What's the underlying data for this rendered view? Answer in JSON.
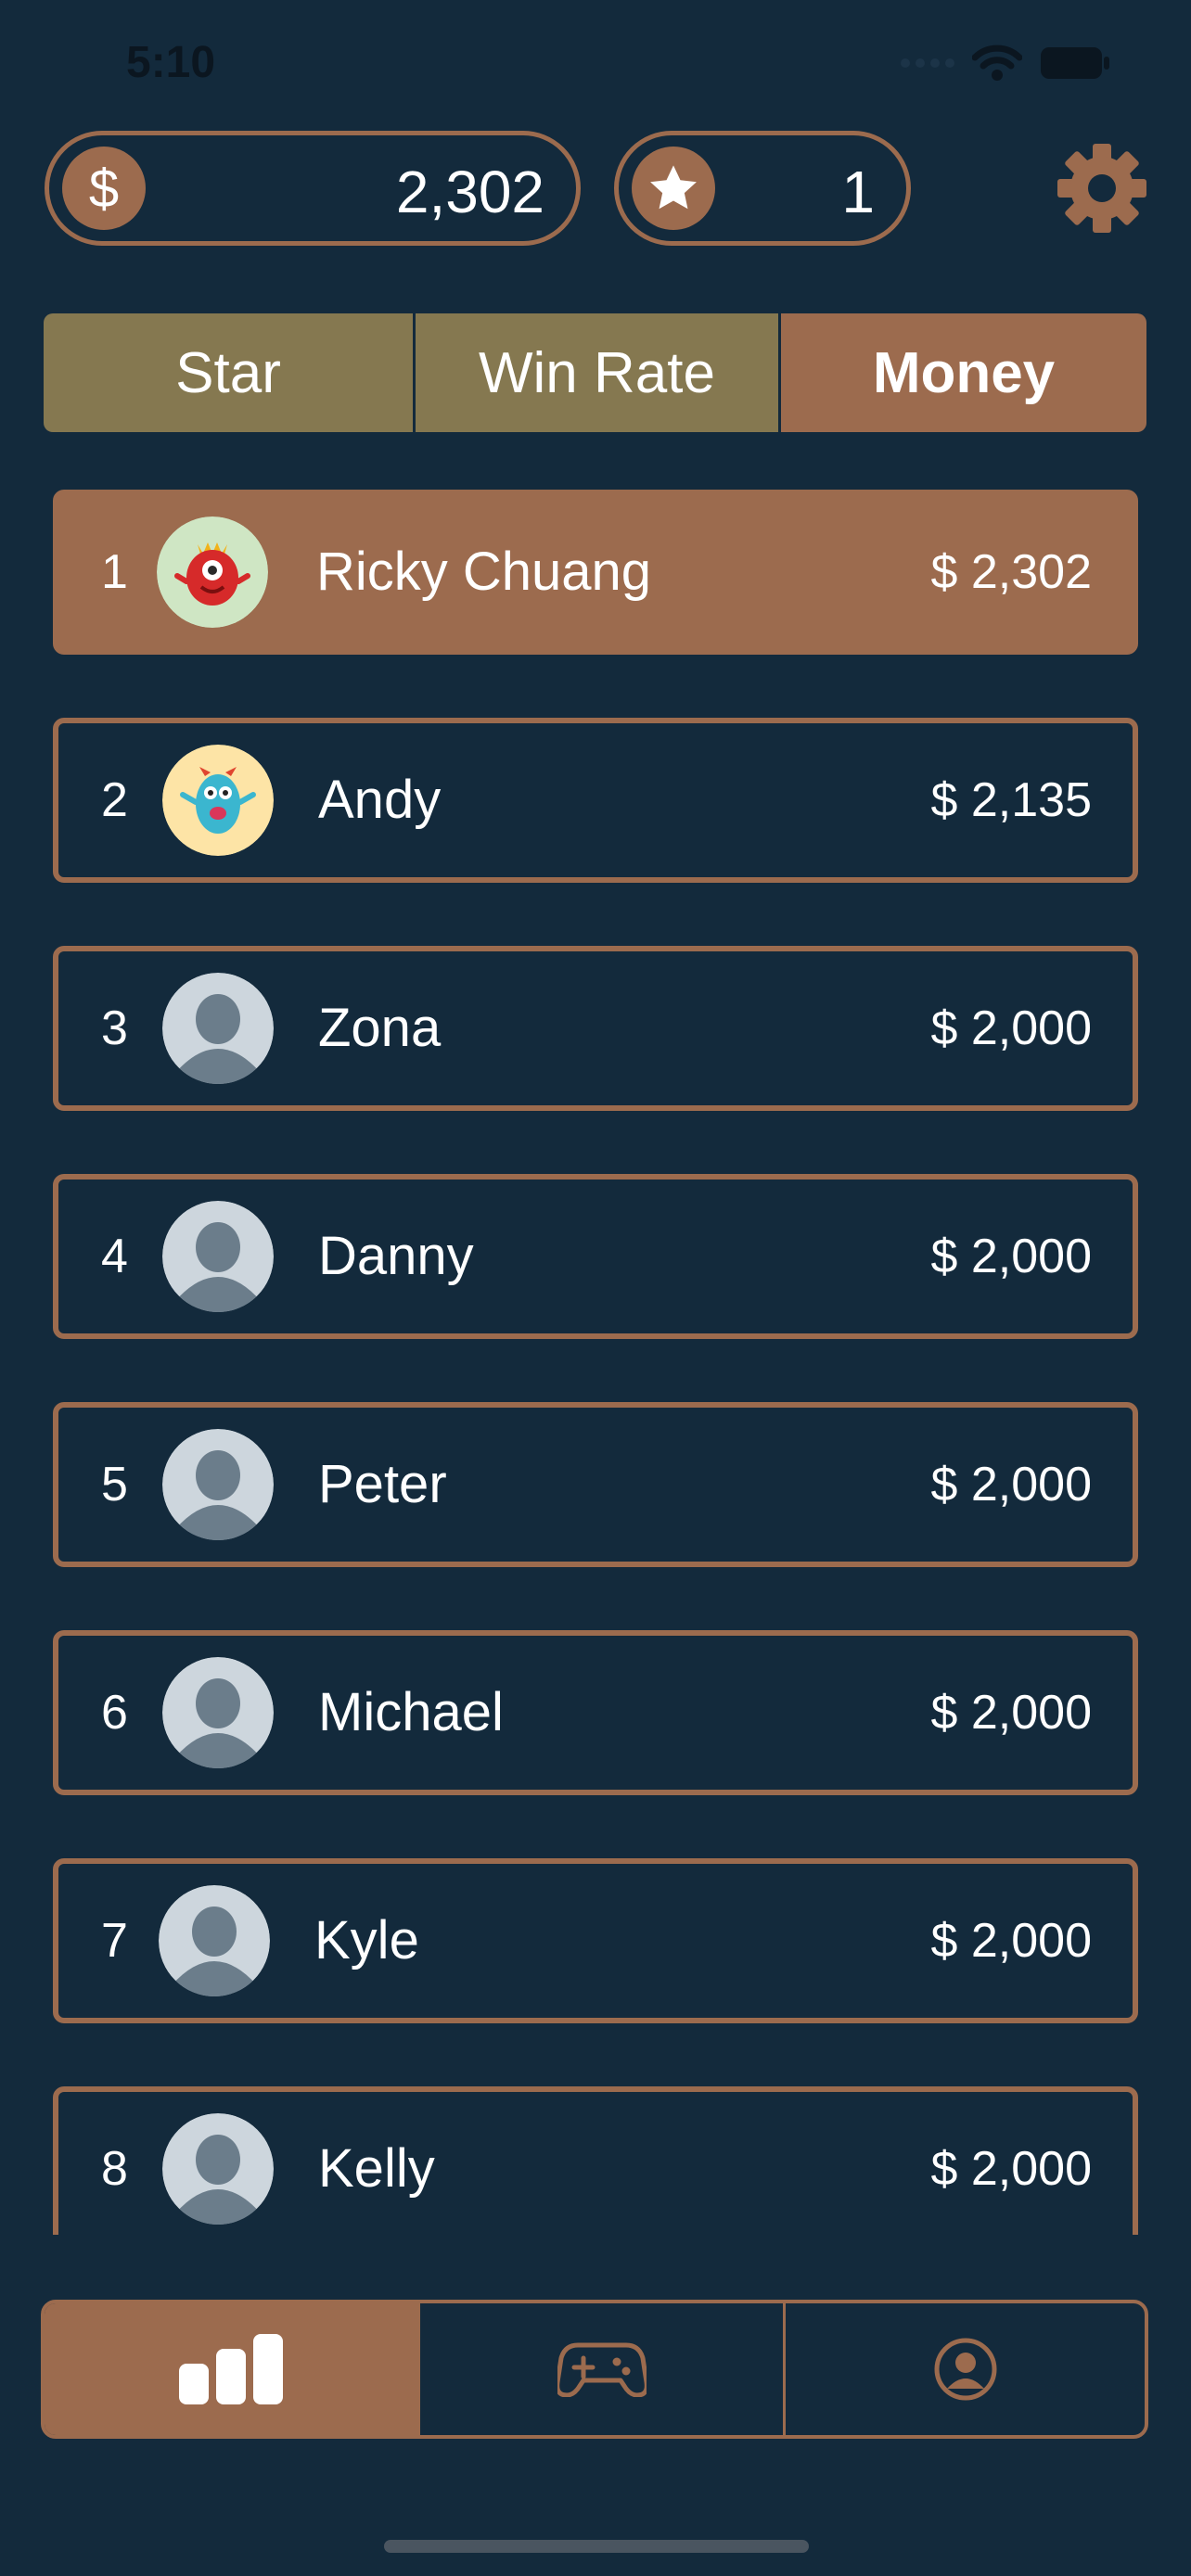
{
  "status_bar": {
    "time": "5:10"
  },
  "header": {
    "money": {
      "icon": "dollar-icon",
      "symbol": "$",
      "value": "2,302"
    },
    "stars": {
      "icon": "star-icon",
      "value": "1"
    },
    "settings_icon": "gear-icon"
  },
  "tabs": [
    {
      "label": "Star",
      "active": false
    },
    {
      "label": "Win Rate",
      "active": false
    },
    {
      "label": "Money",
      "active": true
    }
  ],
  "leaderboard": [
    {
      "rank": "1",
      "name": "Ricky Chuang",
      "amount": "$ 2,302",
      "avatar": "red-monster-avatar",
      "highlighted": true
    },
    {
      "rank": "2",
      "name": "Andy",
      "amount": "$ 2,135",
      "avatar": "blue-monster-avatar",
      "highlighted": false
    },
    {
      "rank": "3",
      "name": "Zona",
      "amount": "$ 2,000",
      "avatar": "default-user-avatar",
      "highlighted": false
    },
    {
      "rank": "4",
      "name": "Danny",
      "amount": "$ 2,000",
      "avatar": "default-user-avatar",
      "highlighted": false
    },
    {
      "rank": "5",
      "name": "Peter",
      "amount": "$ 2,000",
      "avatar": "default-user-avatar",
      "highlighted": false
    },
    {
      "rank": "6",
      "name": "Michael",
      "amount": "$ 2,000",
      "avatar": "default-user-avatar",
      "highlighted": false
    },
    {
      "rank": "7",
      "name": "Kyle",
      "amount": "$ 2,000",
      "avatar": "default-user-avatar",
      "highlighted": false
    },
    {
      "rank": "8",
      "name": "Kelly",
      "amount": "$ 2,000",
      "avatar": "default-user-avatar",
      "highlighted": false
    }
  ],
  "bottom_nav": [
    {
      "icon": "bar-chart-icon",
      "active": true
    },
    {
      "icon": "gamepad-icon",
      "active": false
    },
    {
      "icon": "profile-icon",
      "active": false
    }
  ],
  "colors": {
    "background": "#132a3c",
    "accent": "#9c6b4e",
    "tab_inactive": "#857850",
    "text": "#ffffff"
  }
}
